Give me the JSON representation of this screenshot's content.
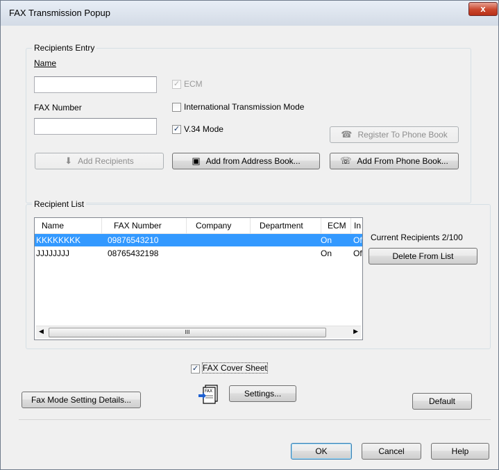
{
  "window": {
    "title": "FAX Transmission Popup",
    "close_glyph": "x"
  },
  "recipients_entry": {
    "group_title": "Recipients Entry",
    "name_label": "Name",
    "name_value": "",
    "fax_number_label": "FAX Number",
    "fax_number_value": "",
    "ecm_label": "ECM",
    "ecm_checked": true,
    "ecm_enabled": false,
    "international_label": "International Transmission Mode",
    "international_checked": false,
    "v34_label": "V.34 Mode",
    "v34_checked": true,
    "register_button": "Register To Phone Book",
    "add_recipients_button": "Add Recipients",
    "add_address_book_button": "Add from Address Book...",
    "add_phone_book_button": "Add From Phone Book..."
  },
  "recipient_list": {
    "group_title": "Recipient List",
    "columns": [
      "Name",
      "FAX Number",
      "Company",
      "Department",
      "ECM",
      "In"
    ],
    "rows": [
      {
        "name": "KKKKKKKK",
        "fax": "09876543210",
        "company": "",
        "department": "",
        "ecm": "On",
        "intl": "Of",
        "selected": true
      },
      {
        "name": "JJJJJJJJ",
        "fax": "08765432198",
        "company": "",
        "department": "",
        "ecm": "On",
        "intl": "Of",
        "selected": false
      }
    ],
    "current_recipients": "Current Recipients 2/100",
    "delete_button": "Delete From List",
    "scroll_grip": "III"
  },
  "cover_sheet": {
    "label": "FAX Cover Sheet",
    "checked": true,
    "settings_button": "Settings..."
  },
  "footer": {
    "fax_mode_button": "Fax Mode Setting Details...",
    "default_button": "Default",
    "ok_button": "OK",
    "cancel_button": "Cancel",
    "help_button": "Help"
  }
}
